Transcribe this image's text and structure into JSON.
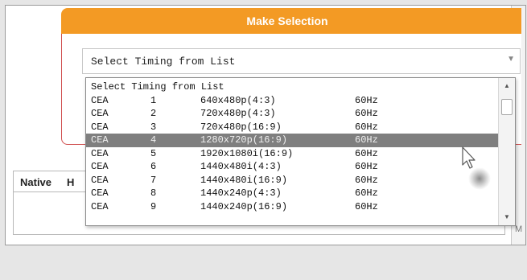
{
  "header": {
    "title": "Make Selection"
  },
  "select": {
    "value": "Select Timing from List"
  },
  "table": {
    "headers": [
      "Native",
      "H"
    ]
  },
  "side_strip": {
    "letter": "M"
  },
  "dropdown": {
    "header_option": "Select Timing from List",
    "options": [
      {
        "standard": "CEA",
        "index": "1",
        "resolution": "640x480p(4:3)",
        "rate": "60Hz"
      },
      {
        "standard": "CEA",
        "index": "2",
        "resolution": "720x480p(4:3)",
        "rate": "60Hz"
      },
      {
        "standard": "CEA",
        "index": "3",
        "resolution": "720x480p(16:9)",
        "rate": "60Hz"
      },
      {
        "standard": "CEA",
        "index": "4",
        "resolution": "1280x720p(16:9)",
        "rate": "60Hz"
      },
      {
        "standard": "CEA",
        "index": "5",
        "resolution": "1920x1080i(16:9)",
        "rate": "60Hz"
      },
      {
        "standard": "CEA",
        "index": "6",
        "resolution": "1440x480i(4:3)",
        "rate": "60Hz"
      },
      {
        "standard": "CEA",
        "index": "7",
        "resolution": "1440x480i(16:9)",
        "rate": "60Hz"
      },
      {
        "standard": "CEA",
        "index": "8",
        "resolution": "1440x240p(4:3)",
        "rate": "60Hz"
      },
      {
        "standard": "CEA",
        "index": "9",
        "resolution": "1440x240p(16:9)",
        "rate": "60Hz"
      }
    ],
    "highlighted_index": "4"
  },
  "colors": {
    "header_orange": "#f39a24",
    "panel_border": "#d05050",
    "highlight_gray": "#7f7f7f"
  },
  "icons": [
    "chevron-down-icon",
    "scroll-up-icon",
    "scroll-down-icon",
    "mouse-pointer-icon"
  ]
}
